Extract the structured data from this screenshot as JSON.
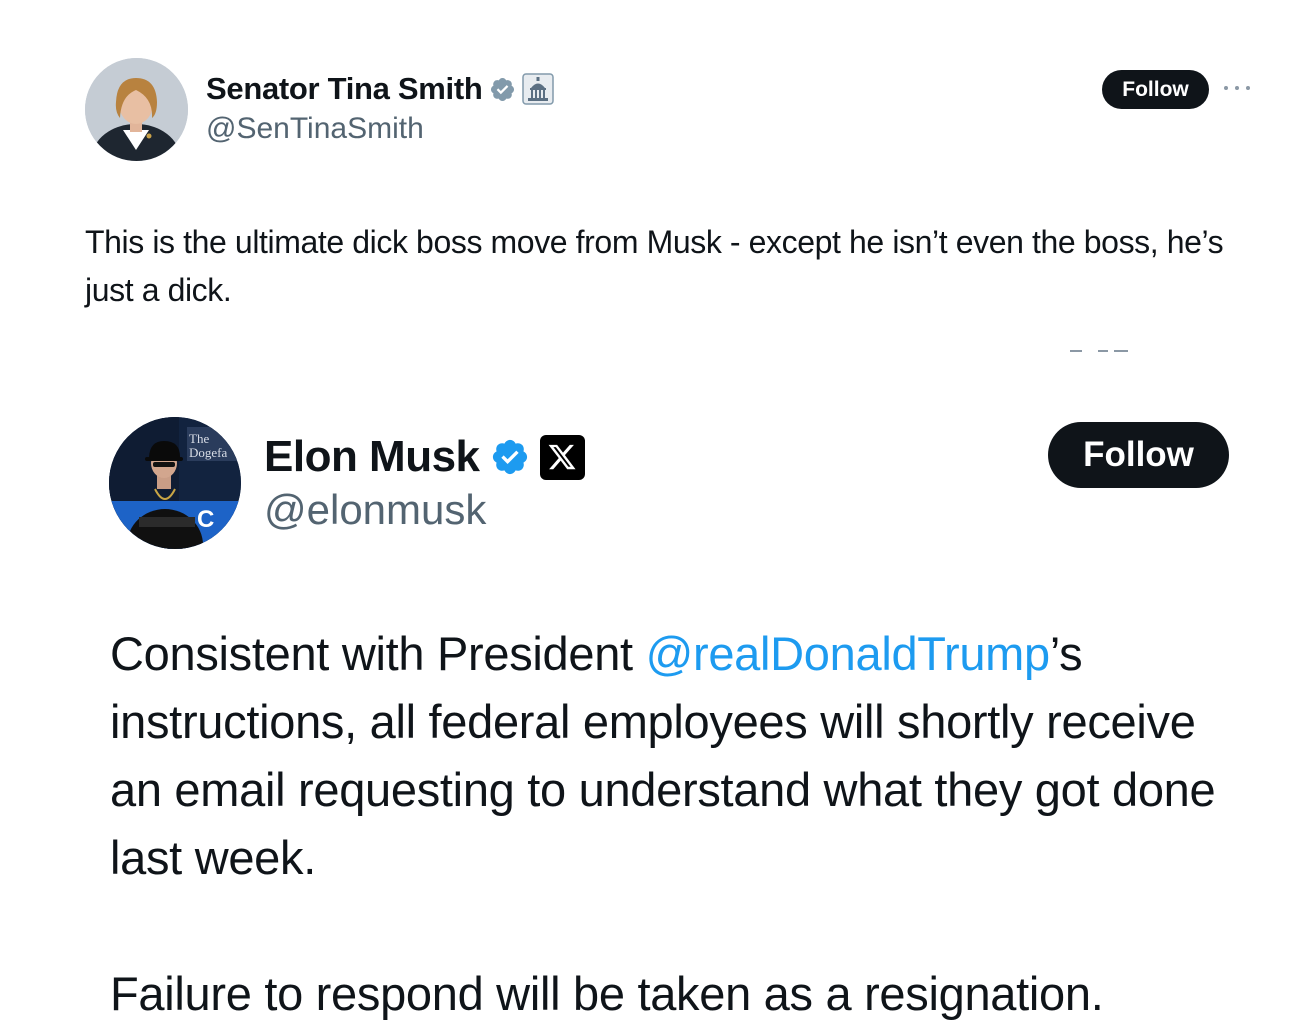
{
  "outer_tweet": {
    "author": {
      "name": "Senator Tina Smith",
      "handle": "@SenTinaSmith",
      "verified_badge": "verified-check-icon",
      "affiliation_badge": "capitol-icon"
    },
    "follow_label": "Follow",
    "more_icon": "more-dots-icon",
    "text": "This is the ultimate dick boss move from Musk - except he isn’t even the boss, he’s just a dick."
  },
  "quoted_tweet": {
    "author": {
      "name": "Elon Musk",
      "handle": "@elonmusk",
      "verified_badge": "verified-check-icon",
      "affiliation_badge": "x-logo-icon"
    },
    "follow_label": "Follow",
    "text_before": "Consistent with President ",
    "mention": "@realDonaldTrump",
    "text_after": "’s instructions, all federal employees will shortly receive an email requesting to understand what they got done last week.",
    "text_second": "Failure to respond will be taken as a resignation."
  },
  "colors": {
    "verified_blue": "#1d9bf0",
    "verified_gray": "#829aab",
    "mention": "#1d9bf0",
    "button_bg": "#0f1419",
    "secondary_text": "#536471"
  }
}
